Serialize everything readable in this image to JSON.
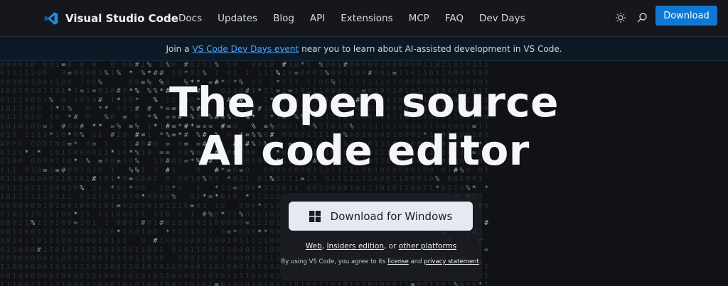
{
  "brand": {
    "name": "Visual Studio Code",
    "accent": "#0e78d4"
  },
  "nav": {
    "links": [
      "Docs",
      "Updates",
      "Blog",
      "API",
      "Extensions",
      "MCP",
      "FAQ",
      "Dev Days"
    ],
    "download_label": "Download",
    "icons": {
      "theme": "sun-icon",
      "search": "search-icon"
    }
  },
  "banner": {
    "prefix": "Join a",
    "link": "VS Code Dev Days event",
    "suffix": "near you to learn about AI-assisted development in VS Code."
  },
  "hero": {
    "line1": "The open source",
    "line2": "AI code editor",
    "download_windows": "Download for Windows",
    "alt_web": "Web",
    "alt_sep1": ", ",
    "alt_insiders": "Insiders edition",
    "alt_sep2": ", or ",
    "alt_other": "other platforms",
    "legal_prefix": "By using VS Code, you agree to its",
    "legal_license": "license",
    "legal_and": "and",
    "legal_privacy": "privacy statement",
    "legal_end": "."
  },
  "background": {
    "hidden_text": "APPY_CODING"
  }
}
